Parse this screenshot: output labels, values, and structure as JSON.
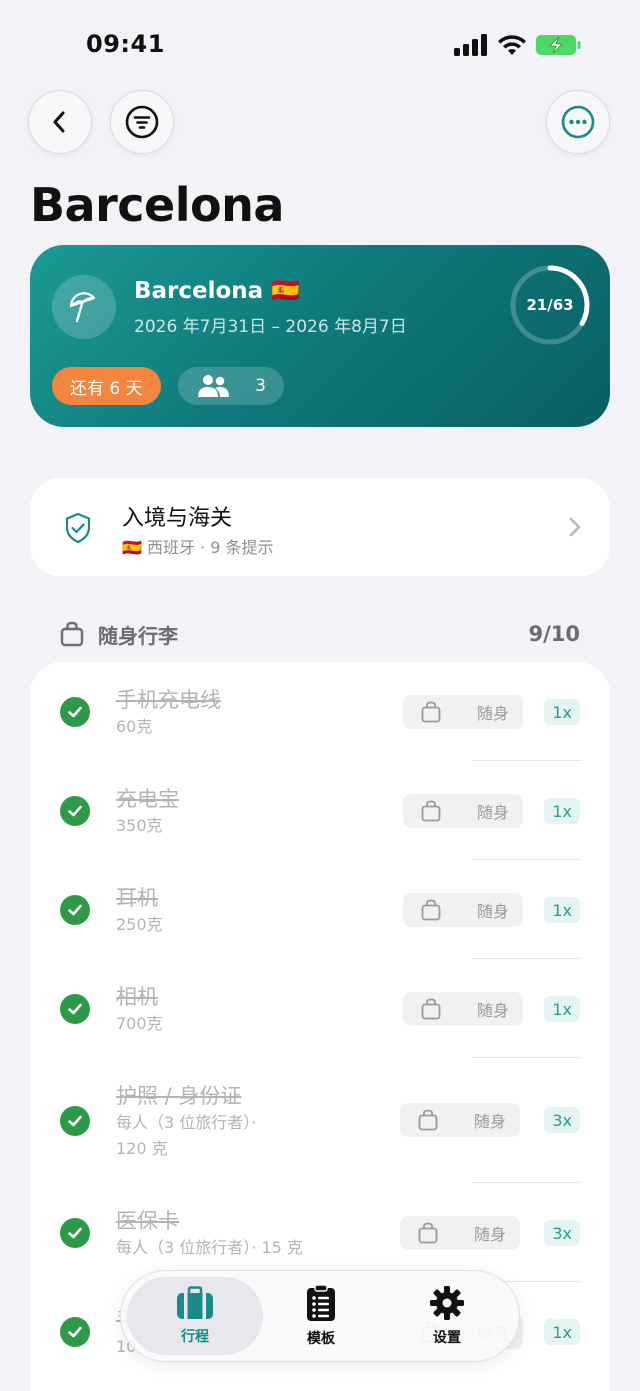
{
  "status_bar": {
    "time": "09:41"
  },
  "page": {
    "title": "Barcelona"
  },
  "trip": {
    "name": "Barcelona 🇪🇸",
    "dates": "2026 年7月31日 – 2026 年8月7日",
    "progress_label": "21/63",
    "progress_fraction": 0.333,
    "days_left": "还有 6 天",
    "travelers": "3"
  },
  "customs": {
    "title": "入境与海关",
    "subtitle": "🇪🇸 西班牙 · 9 条提示"
  },
  "section": {
    "title": "随身行李",
    "count": "9/10"
  },
  "items": [
    {
      "name": "手机充电线",
      "weight_lines": [
        "60克"
      ],
      "bag": "随身",
      "qty": "1x"
    },
    {
      "name": "充电宝",
      "weight_lines": [
        "350克"
      ],
      "bag": "随身",
      "qty": "1x"
    },
    {
      "name": "耳机",
      "weight_lines": [
        "250克"
      ],
      "bag": "随身",
      "qty": "1x"
    },
    {
      "name": "相机",
      "weight_lines": [
        "700克"
      ],
      "bag": "随身",
      "qty": "1x"
    },
    {
      "name": "护照 / 身份证",
      "weight_lines": [
        "每人（3 位旅行者）·",
        "120 克"
      ],
      "bag": "随身",
      "qty": "3x"
    },
    {
      "name": "医保卡",
      "weight_lines": [
        "每人（3 位旅行者）· 15 克"
      ],
      "bag": "随身",
      "qty": "3x"
    },
    {
      "name": "手",
      "weight_lines": [
        "10"
      ],
      "bag": "随身",
      "qty": "1x"
    }
  ],
  "tabs": [
    {
      "label": "行程",
      "active": true
    },
    {
      "label": "模板",
      "active": false
    },
    {
      "label": "设置",
      "active": false
    }
  ],
  "colors": {
    "accent": "#1a8a88",
    "check": "#2e9a47",
    "badge_orange": "#f4853e"
  }
}
